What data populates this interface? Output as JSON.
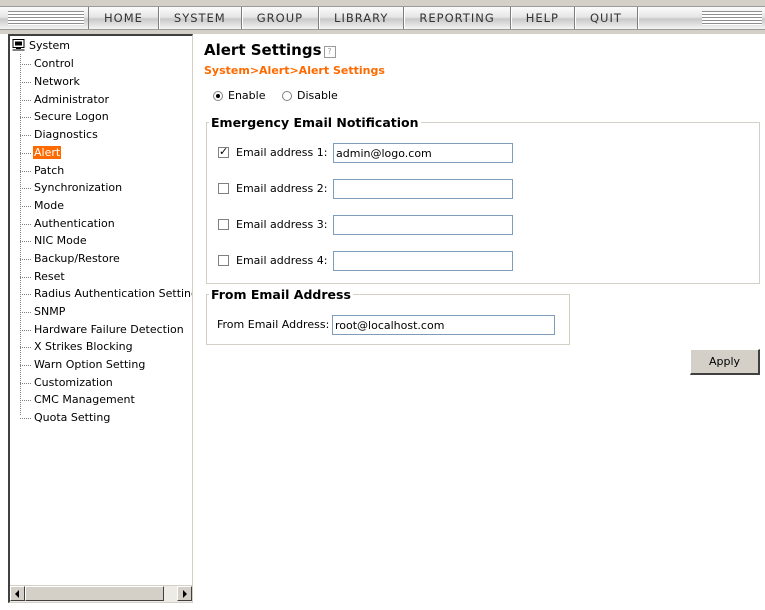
{
  "nav": {
    "items": [
      "HOME",
      "SYSTEM",
      "GROUP",
      "LIBRARY",
      "REPORTING",
      "HELP",
      "QUIT"
    ]
  },
  "sidebar": {
    "root": "System",
    "selected": "Alert",
    "items": [
      "Control",
      "Network",
      "Administrator",
      "Secure Logon",
      "Diagnostics",
      "Alert",
      "Patch",
      "Synchronization",
      "Mode",
      "Authentication",
      "NIC Mode",
      "Backup/Restore",
      "Reset",
      "Radius Authentication Setting",
      "SNMP",
      "Hardware Failure Detection",
      "X Strikes Blocking",
      "Warn Option Setting",
      "Customization",
      "CMC Management",
      "Quota Setting"
    ]
  },
  "main": {
    "title": "Alert Settings",
    "breadcrumb": "System>Alert>Alert Settings",
    "enable_label": "Enable",
    "disable_label": "Disable",
    "alert_enabled": true,
    "emergency": {
      "legend": "Emergency Email Notification",
      "rows": [
        {
          "label": "Email address 1:",
          "checked": true,
          "value": "admin@logo.com"
        },
        {
          "label": "Email address 2:",
          "checked": false,
          "value": ""
        },
        {
          "label": "Email address 3:",
          "checked": false,
          "value": ""
        },
        {
          "label": "Email address 4:",
          "checked": false,
          "value": ""
        }
      ]
    },
    "from": {
      "legend": "From Email Address",
      "label": "From Email Address:",
      "value": "root@localhost.com"
    },
    "apply_label": "Apply"
  },
  "colors": {
    "accent": "#ff6a00",
    "chrome": "#d4d0c8"
  }
}
